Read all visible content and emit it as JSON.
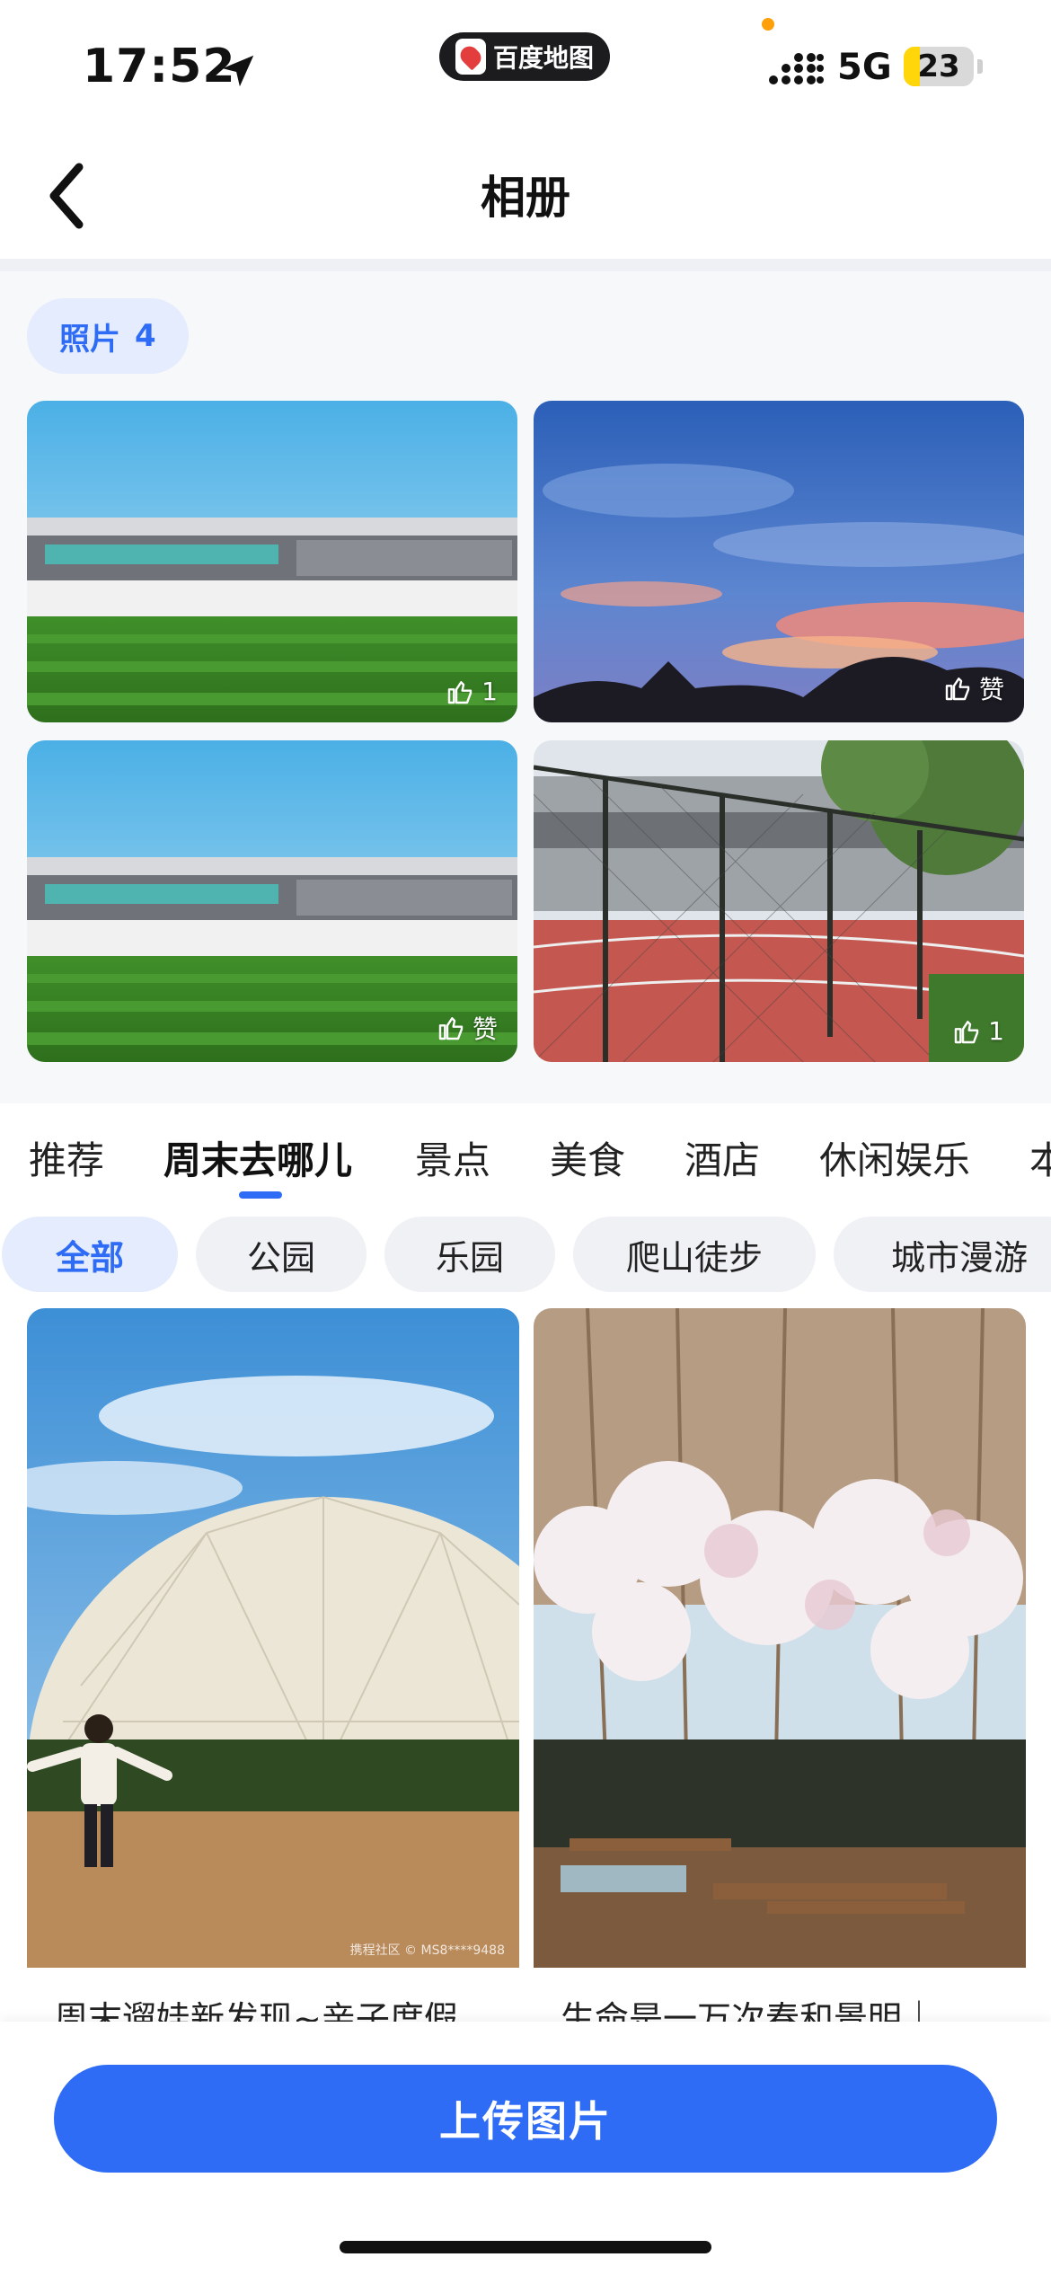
{
  "status_bar": {
    "time": "17:52",
    "app_pill_label": "百度地图",
    "network": "5G",
    "battery": "23",
    "battery_level": 0.23,
    "colors": {
      "battery_fill": "#ffd60a",
      "recording_dot": "#ff9f0a"
    }
  },
  "nav": {
    "title": "相册",
    "back_icon": "chevron-left-icon"
  },
  "album": {
    "count_label": "照片",
    "count": "4",
    "photos": [
      {
        "subject": "stadium-building-with-green-field",
        "like_label": "1"
      },
      {
        "subject": "sunset-sky-with-pink-clouds",
        "like_label": "赞"
      },
      {
        "subject": "stadium-building-with-green-field",
        "like_label": "赞"
      },
      {
        "subject": "running-track-behind-fence",
        "like_label": "1"
      }
    ],
    "like_icon": "thumbs-up-icon"
  },
  "category_tabs": [
    {
      "label": "推荐",
      "active": false
    },
    {
      "label": "周末去哪儿",
      "active": true
    },
    {
      "label": "景点",
      "active": false
    },
    {
      "label": "美食",
      "active": false
    },
    {
      "label": "酒店",
      "active": false
    },
    {
      "label": "休闲娱乐",
      "active": false
    },
    {
      "label": "本",
      "active": false
    }
  ],
  "filters": [
    {
      "label": "全部",
      "active": true
    },
    {
      "label": "公园",
      "active": false
    },
    {
      "label": "乐园",
      "active": false
    },
    {
      "label": "爬山徒步",
      "active": false
    },
    {
      "label": "城市漫游",
      "active": false
    }
  ],
  "feed": [
    {
      "caption": "周末遛娃新发现~亲子度假",
      "watermark": "携程社区 © MS8****9488",
      "subject": "girl-in-front-of-white-dome"
    },
    {
      "caption": "生命是一万次春和景明｜",
      "watermark": "",
      "subject": "magnolia-trees-with-deck-chairs"
    }
  ],
  "upload_button": "上传图片",
  "colors": {
    "accent": "#2f6cf6",
    "chip_bg": "#e4ecfd",
    "section_bg": "#f7f8fa"
  }
}
